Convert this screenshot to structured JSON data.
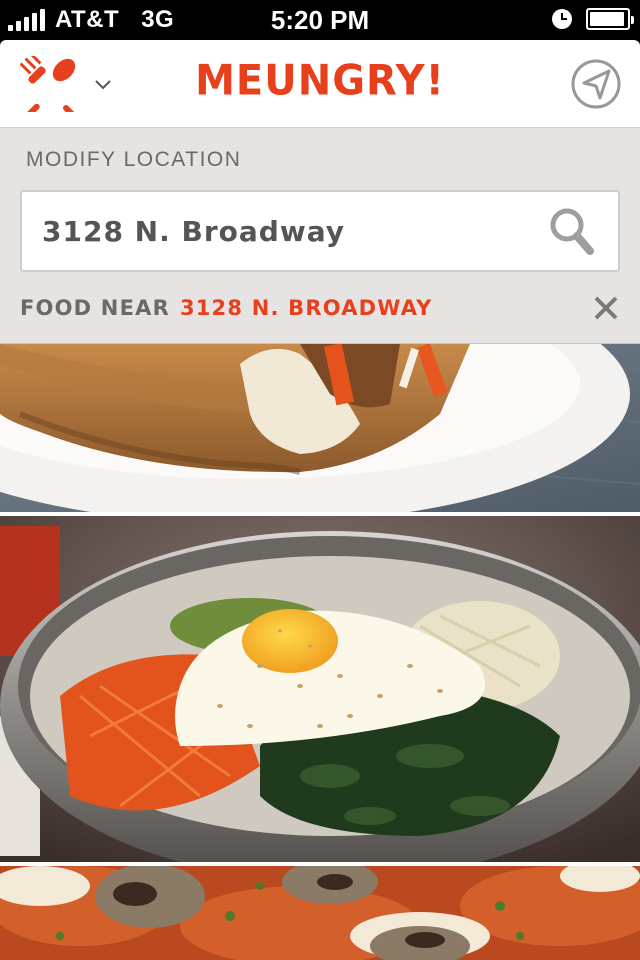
{
  "status_bar": {
    "carrier": "AT&T",
    "network": "3G",
    "time": "5:20 PM",
    "signal_bars": 5,
    "battery_level": 0.95
  },
  "header": {
    "brand": "MEUNGRY!",
    "menu_icon": "fork-spoon-icon",
    "dropdown_icon": "chevron-down-icon",
    "locate_icon": "location-arrow-icon",
    "brand_color": "#e8401c"
  },
  "location": {
    "label": "MODIFY LOCATION",
    "search_value": "3128 N. Broadway",
    "search_icon": "search-icon",
    "near_prefix": "FOOD NEAR",
    "near_address": "3128 N. BROADWAY",
    "close_icon": "close-icon"
  },
  "feed": {
    "items": [
      {
        "image": "banh-mi-sandwich-photo"
      },
      {
        "image": "bibimbap-bowl-photo"
      },
      {
        "image": "mushroom-pizza-photo"
      }
    ]
  }
}
